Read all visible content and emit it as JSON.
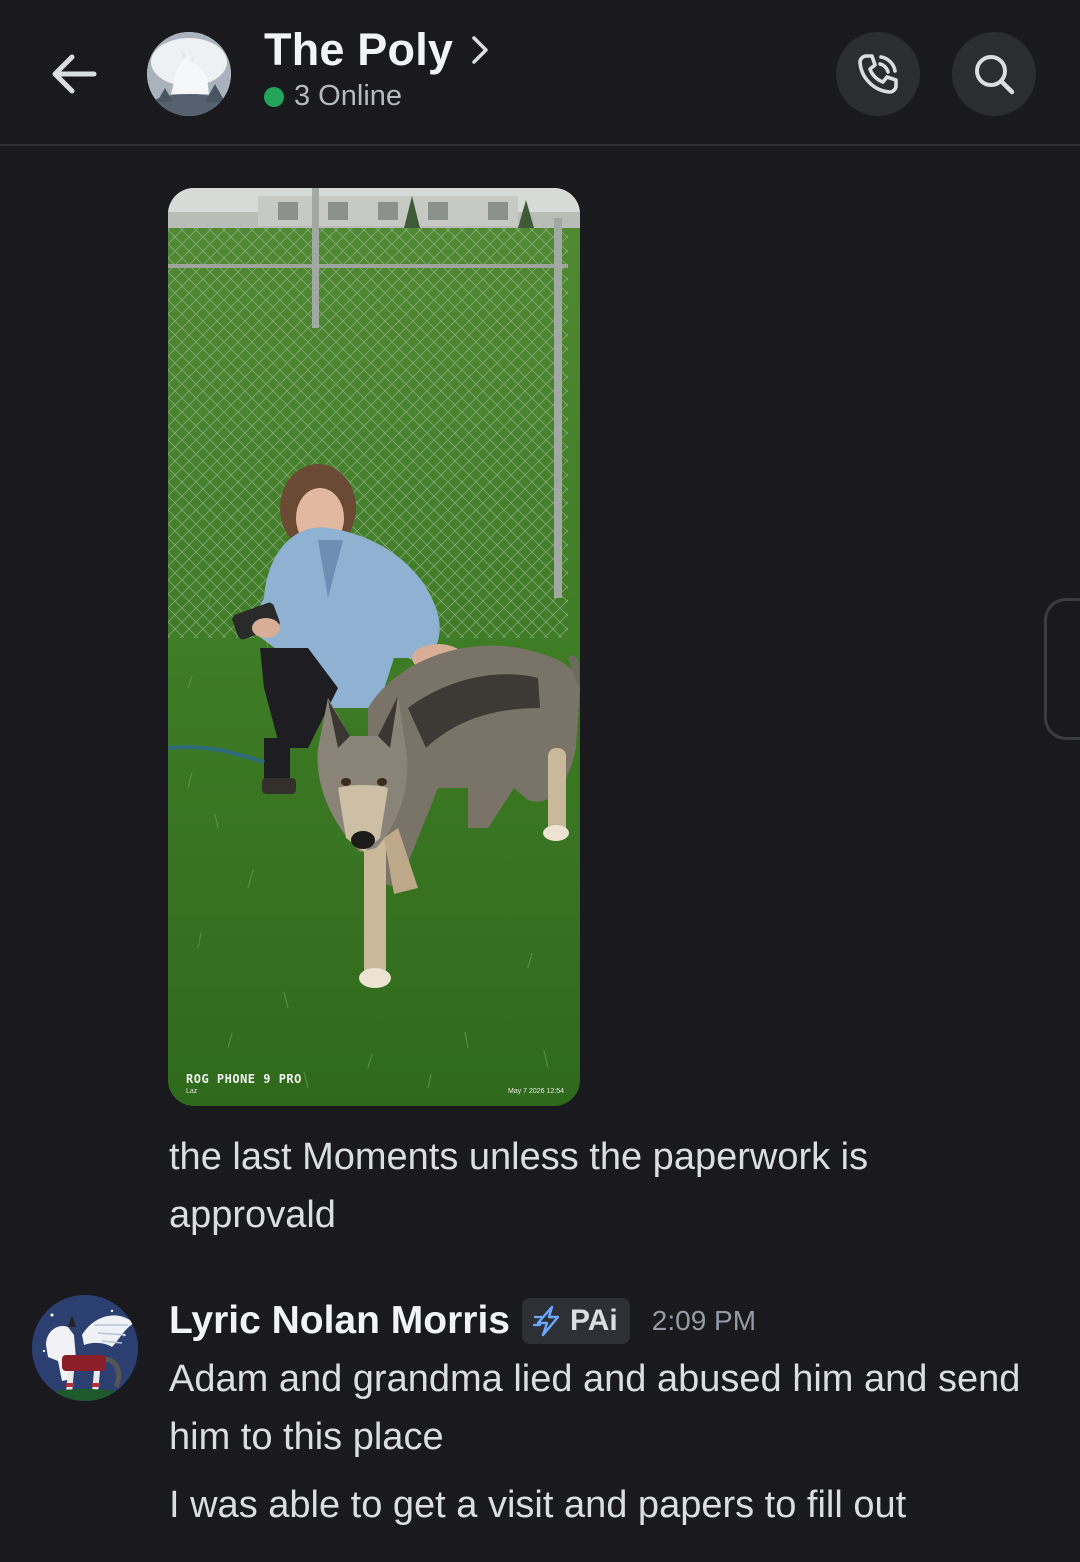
{
  "header": {
    "title": "The Poly",
    "online_text": "3 Online",
    "icons": [
      "back-arrow-icon",
      "chevron-right-icon",
      "phone-call-icon",
      "search-icon"
    ]
  },
  "photo": {
    "watermark": "ROG PHONE 9 PRO",
    "watermark_sub": "Laz",
    "date_stamp": "May 7 2026 12:54"
  },
  "messages": [
    {
      "text": "the last Moments unless the paperwork is approvald"
    },
    {
      "author": "Lyric Nolan Morris",
      "tag": "PAi",
      "timestamp": "2:09 PM",
      "lines": [
        "Adam and grandma lied and abused him and send him to this place",
        "I was able to get a visit and papers to fill out"
      ]
    }
  ],
  "colors": {
    "background": "#1a1a1e",
    "online": "#23a55a",
    "button_bg": "#2b2d31"
  }
}
